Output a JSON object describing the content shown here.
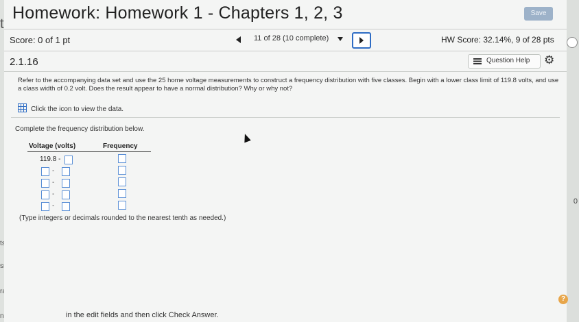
{
  "header": {
    "title": "Homework: Homework 1 - Chapters 1, 2, 3",
    "save_label": "Save"
  },
  "score_bar": {
    "score": "Score: 0 of 1 pt",
    "question_nav": "11 of 28 (10 complete)",
    "hw_score": "HW Score: 32.14%, 9 of 28 pts"
  },
  "question": {
    "number": "2.1.16",
    "help_label": "Question Help",
    "text": "Refer to the accompanying data set and use the 25 home voltage measurements to construct a frequency distribution with five classes. Begin with a lower class limit of 119.8 volts, and use a class width of 0.2 volt. Does the result appear to have a normal distribution? Why or why not?",
    "data_link": "Click the icon to view the data.",
    "instruction": "Complete the frequency distribution below.",
    "table": {
      "col_voltage": "Voltage (volts)",
      "col_frequency": "Frequency",
      "first_lower": "119.8",
      "dash": "-"
    },
    "note": "(Type integers or decimals rounded to the nearest tenth as needed.)"
  },
  "footer": {
    "instruction": "in the edit fields and then click Check Answer."
  },
  "side_fragments": {
    "left_top": "t",
    "left_1": "ts",
    "left_2": "ss",
    "left_3": "ra",
    "left_4": "ns",
    "right_1": "0"
  },
  "colors": {
    "accent": "#2e6cc4",
    "save_button": "#9db2c9",
    "help_circle": "#e8a64a"
  }
}
